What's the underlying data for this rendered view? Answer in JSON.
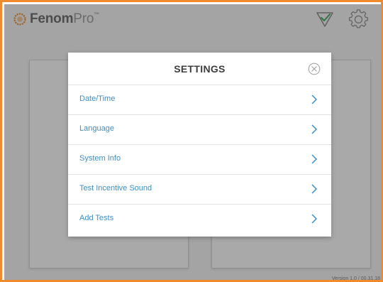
{
  "app": {
    "brand_primary": "Fenom",
    "brand_secondary": "Pro",
    "brand_mark": "™",
    "version": "Version 1.0 / 00.31.18"
  },
  "header": {
    "icons": [
      "check-icon",
      "gear-icon"
    ]
  },
  "modal": {
    "title": "SETTINGS",
    "close_icon": "close-icon",
    "items": [
      {
        "label": "Date/Time"
      },
      {
        "label": "Language"
      },
      {
        "label": "System Info"
      },
      {
        "label": "Test Incentive Sound"
      },
      {
        "label": "Add Tests"
      }
    ]
  },
  "colors": {
    "frame": "#f08a2c",
    "accent": "#3f8fc8",
    "check_green": "#3da65a"
  }
}
